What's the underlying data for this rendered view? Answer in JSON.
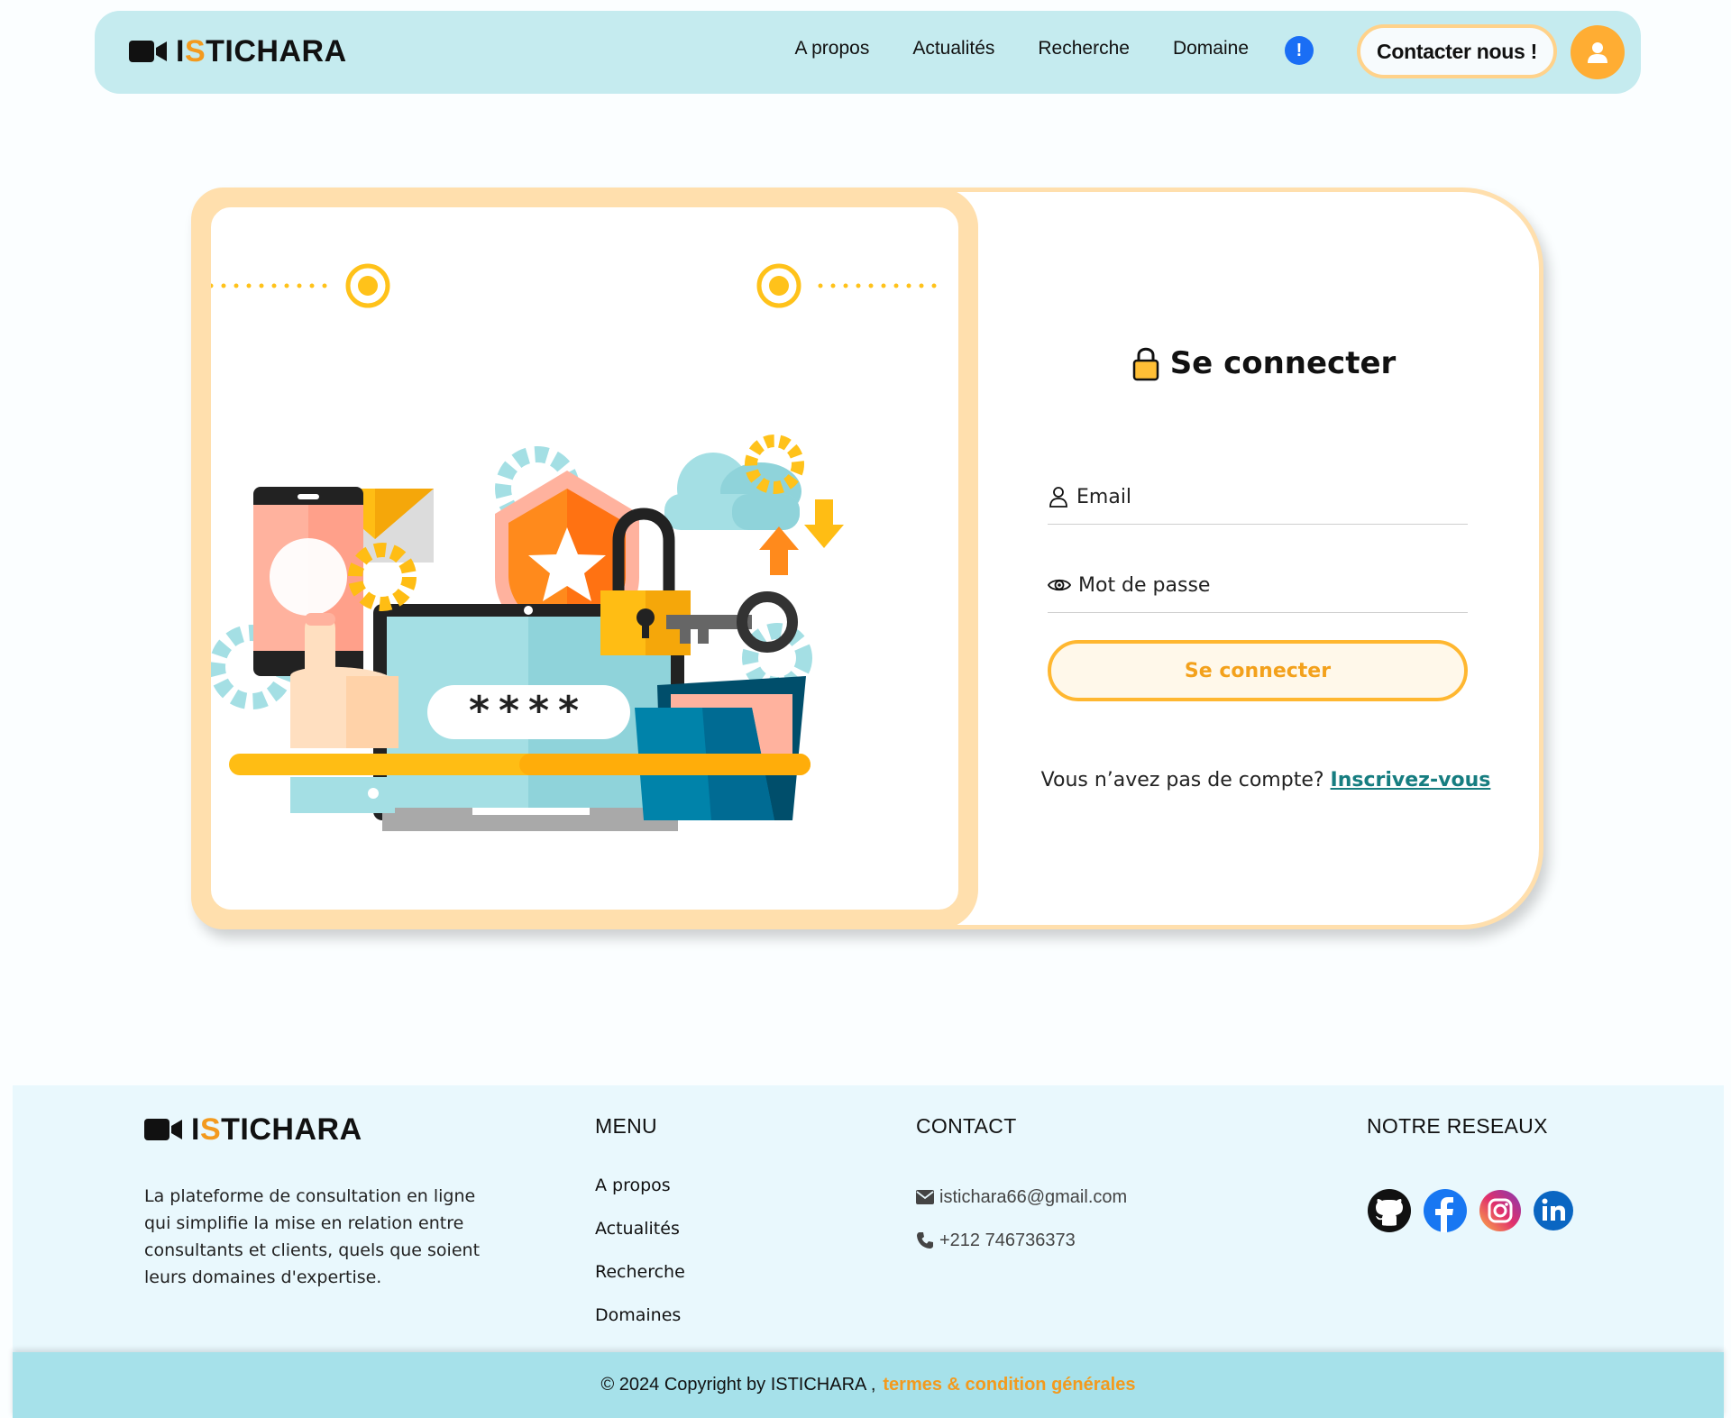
{
  "brand": {
    "prefix": "I",
    "accent": "S",
    "rest": "TICHARA"
  },
  "nav": {
    "links": [
      "A propos",
      "Actualités",
      "Recherche",
      "Domaine"
    ],
    "info_glyph": "!",
    "contact_label": "Contacter nous !",
    "icons": {
      "info": "info-icon",
      "user": "user-icon"
    }
  },
  "login": {
    "title": "Se connecter",
    "email_placeholder": "Email",
    "password_placeholder": "Mot de passe",
    "submit_label": "Se connecter",
    "signup_prompt": "Vous n’avez pas de compte?",
    "signup_link": "Inscrivez-vous",
    "illustration_password": "****"
  },
  "footer": {
    "description": "La plateforme de consultation en ligne qui simplifie la mise en relation entre consultants et clients, quels que soient leurs domaines d'expertise.",
    "menu_heading": "MENU",
    "menu_items": [
      "A propos",
      "Actualités",
      "Recherche",
      "Domaines"
    ],
    "contact_heading": "CONTACT",
    "email": "istichara66@gmail.com",
    "phone": "+212 746736373",
    "social_heading": "NOTRE RESEAUX",
    "socials": [
      "github-icon",
      "facebook-icon",
      "instagram-icon",
      "linkedin-icon"
    ]
  },
  "copyright": {
    "text": "© 2024 Copyright by ISTICHARA ,",
    "terms": "termes & condition générales"
  },
  "colors": {
    "accent": "#f39a1e",
    "nav_bg": "#c5ebef",
    "footer_bg": "#e9f8fd",
    "bottom_bar": "#a6e1ea",
    "link_teal": "#167d80"
  }
}
